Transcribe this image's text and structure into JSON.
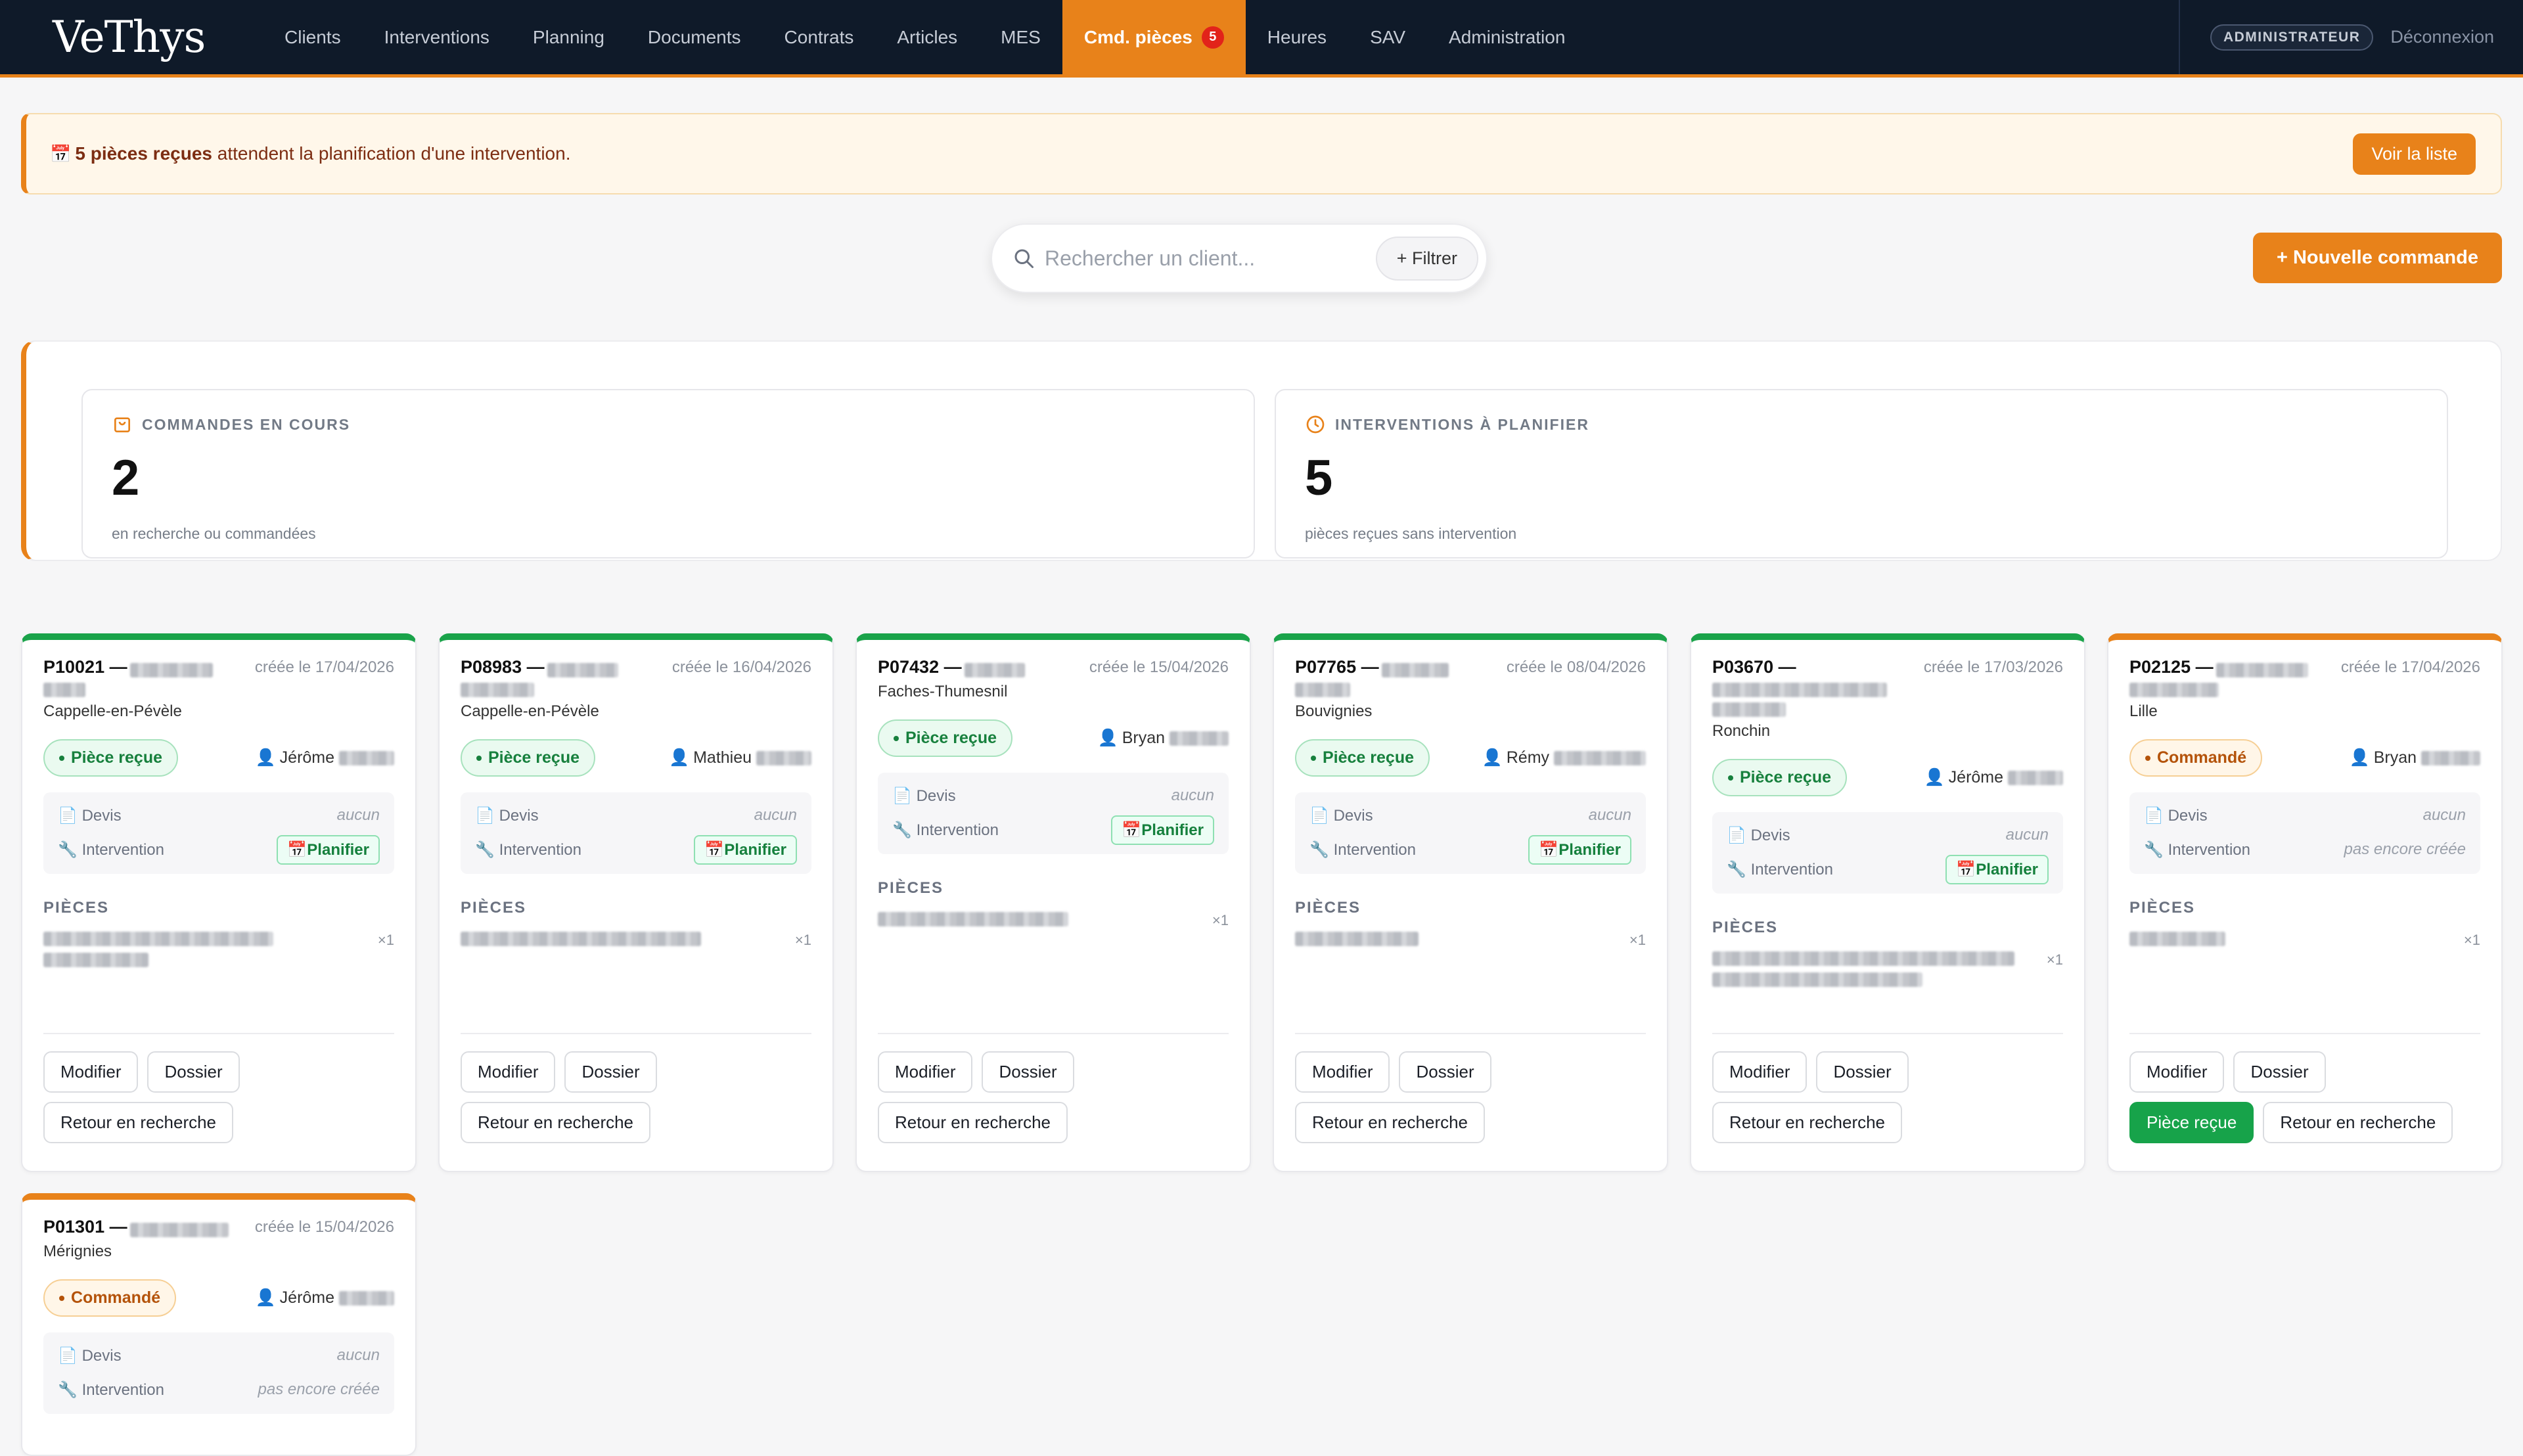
{
  "app": {
    "logo": "VeThys"
  },
  "nav": {
    "items": [
      "Clients",
      "Interventions",
      "Planning",
      "Documents",
      "Contrats",
      "Articles",
      "MES",
      "Cmd. pièces",
      "Heures",
      "SAV",
      "Administration"
    ],
    "active_badge": "5",
    "role": "ADMINISTRATEUR",
    "logout": "Déconnexion"
  },
  "alert": {
    "icon": "📅",
    "count_text": "5 pièces reçues",
    "rest_text": " attendent la planification d'une intervention.",
    "button": "Voir la liste"
  },
  "search": {
    "placeholder": "Rechercher un client...",
    "filter_label": "+ Filtrer"
  },
  "new_order_label": "+ Nouvelle commande",
  "stats": [
    {
      "title": "COMMANDES EN COURS",
      "value": "2",
      "sub": "en recherche ou commandées",
      "icon": "cart-icon"
    },
    {
      "title": "INTERVENTIONS À PLANIFIER",
      "value": "5",
      "sub": "pièces reçues sans intervention",
      "icon": "clock-icon"
    }
  ],
  "labels": {
    "devis": "Devis",
    "intervention": "Intervention",
    "aucun": "aucun",
    "planifier": "Planifier",
    "pas_encore": "pas encore créée",
    "pieces": "PIÈCES",
    "modifier": "Modifier",
    "dossier": "Dossier",
    "retour": "Retour en recherche",
    "piece_recue": "Pièce reçue",
    "qty": "×1"
  },
  "cards": [
    {
      "id": "P10021 —",
      "date": "créée le 17/04/2026",
      "city": "Cappelle-en-Pévèle",
      "status": "Pièce reçue",
      "tech": "Jérôme"
    },
    {
      "id": "P08983 —",
      "date": "créée le 16/04/2026",
      "city": "Cappelle-en-Pévèle",
      "status": "Pièce reçue",
      "tech": "Mathieu"
    },
    {
      "id": "P07432 —",
      "date": "créée le 15/04/2026",
      "city": "Faches-Thumesnil",
      "status": "Pièce reçue",
      "tech": "Bryan"
    },
    {
      "id": "P07765 —",
      "date": "créée le 08/04/2026",
      "city": "Bouvignies",
      "status": "Pièce reçue",
      "tech": "Rémy"
    },
    {
      "id": "P03670 —",
      "date": "créée le 17/03/2026",
      "city": "Ronchin",
      "status": "Pièce reçue",
      "tech": "Jérôme"
    },
    {
      "id": "P02125 —",
      "date": "créée le 17/04/2026",
      "city": "Lille",
      "status": "Commandé",
      "tech": "Bryan"
    },
    {
      "id": "P01301 —",
      "date": "créée le 15/04/2026",
      "city": "Mérignies",
      "status": "Commandé",
      "tech": "Jérôme"
    }
  ]
}
